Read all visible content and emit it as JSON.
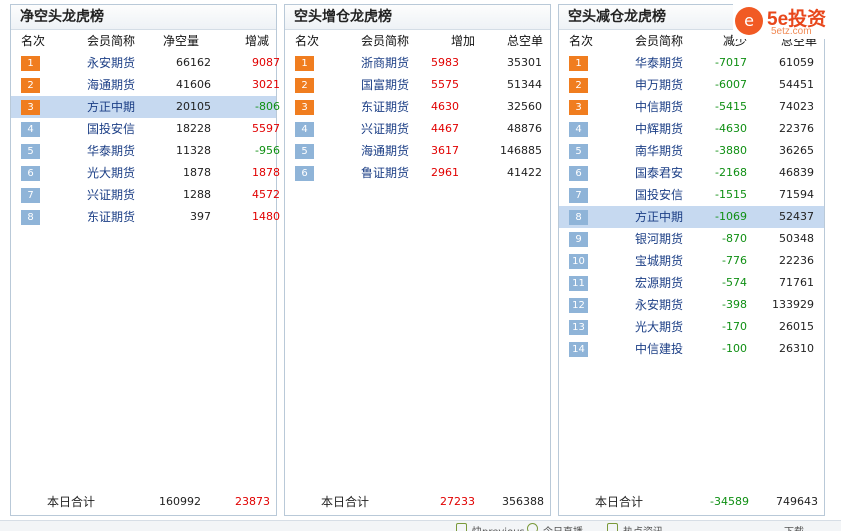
{
  "panels": [
    {
      "title": "净空头龙虎榜",
      "headers": [
        "名次",
        "会员简称",
        "净空量",
        "增减"
      ],
      "rows": [
        {
          "rank": "1",
          "name": "永安期货",
          "v1": "66162",
          "v2": "9087",
          "c2": "red"
        },
        {
          "rank": "2",
          "name": "海通期货",
          "v1": "41606",
          "v2": "3021",
          "c2": "red"
        },
        {
          "rank": "3",
          "name": "方正中期",
          "v1": "20105",
          "v2": "-806",
          "c2": "green",
          "selected": true
        },
        {
          "rank": "4",
          "name": "国投安信",
          "v1": "18228",
          "v2": "5597",
          "c2": "red"
        },
        {
          "rank": "5",
          "name": "华泰期货",
          "v1": "11328",
          "v2": "-956",
          "c2": "green"
        },
        {
          "rank": "6",
          "name": "光大期货",
          "v1": "1878",
          "v2": "1878",
          "c2": "red"
        },
        {
          "rank": "7",
          "name": "兴证期货",
          "v1": "1288",
          "v2": "4572",
          "c2": "red"
        },
        {
          "rank": "8",
          "name": "东证期货",
          "v1": "397",
          "v2": "1480",
          "c2": "red"
        }
      ],
      "total": {
        "label": "本日合计",
        "v1": "160992",
        "v2": "23873",
        "c1": "black",
        "c2": "red"
      }
    },
    {
      "title": "空头增仓龙虎榜",
      "headers": [
        "名次",
        "会员简称",
        "增加",
        "总空单"
      ],
      "rows": [
        {
          "rank": "1",
          "name": "浙商期货",
          "v1": "5983",
          "v2": "35301",
          "c1": "red"
        },
        {
          "rank": "2",
          "name": "国富期货",
          "v1": "5575",
          "v2": "51344",
          "c1": "red"
        },
        {
          "rank": "3",
          "name": "东证期货",
          "v1": "4630",
          "v2": "32560",
          "c1": "red"
        },
        {
          "rank": "4",
          "name": "兴证期货",
          "v1": "4467",
          "v2": "48876",
          "c1": "red"
        },
        {
          "rank": "5",
          "name": "海通期货",
          "v1": "3617",
          "v2": "146885",
          "c1": "red"
        },
        {
          "rank": "6",
          "name": "鲁证期货",
          "v1": "2961",
          "v2": "41422",
          "c1": "red"
        }
      ],
      "total": {
        "label": "本日合计",
        "v1": "27233",
        "v2": "356388",
        "c1": "red",
        "c2": "black"
      }
    },
    {
      "title": "空头减仓龙虎榜",
      "headers": [
        "名次",
        "会员简称",
        "减少",
        "总空单"
      ],
      "rows": [
        {
          "rank": "1",
          "name": "华泰期货",
          "v1": "-7017",
          "v2": "61059",
          "c1": "green"
        },
        {
          "rank": "2",
          "name": "申万期货",
          "v1": "-6007",
          "v2": "54451",
          "c1": "green"
        },
        {
          "rank": "3",
          "name": "中信期货",
          "v1": "-5415",
          "v2": "74023",
          "c1": "green"
        },
        {
          "rank": "4",
          "name": "中辉期货",
          "v1": "-4630",
          "v2": "22376",
          "c1": "green"
        },
        {
          "rank": "5",
          "name": "南华期货",
          "v1": "-3880",
          "v2": "36265",
          "c1": "green"
        },
        {
          "rank": "6",
          "name": "国泰君安",
          "v1": "-2168",
          "v2": "46839",
          "c1": "green"
        },
        {
          "rank": "7",
          "name": "国投安信",
          "v1": "-1515",
          "v2": "71594",
          "c1": "green"
        },
        {
          "rank": "8",
          "name": "方正中期",
          "v1": "-1069",
          "v2": "52437",
          "c1": "green",
          "selected": true
        },
        {
          "rank": "9",
          "name": "银河期货",
          "v1": "-870",
          "v2": "50348",
          "c1": "green"
        },
        {
          "rank": "10",
          "name": "宝城期货",
          "v1": "-776",
          "v2": "22236",
          "c1": "green"
        },
        {
          "rank": "11",
          "name": "宏源期货",
          "v1": "-574",
          "v2": "71761",
          "c1": "green"
        },
        {
          "rank": "12",
          "name": "永安期货",
          "v1": "-398",
          "v2": "133929",
          "c1": "green"
        },
        {
          "rank": "13",
          "name": "光大期货",
          "v1": "-170",
          "v2": "26015",
          "c1": "green"
        },
        {
          "rank": "14",
          "name": "中信建投",
          "v1": "-100",
          "v2": "26310",
          "c1": "green"
        }
      ],
      "total": {
        "label": "本日合计",
        "v1": "-34589",
        "v2": "749643",
        "c1": "green",
        "c2": "black"
      }
    }
  ],
  "logo": {
    "mark": "e",
    "text": "5e投资",
    "sub": "5etz.com"
  },
  "statusbar": {
    "items": [
      "快previous",
      "今日直播",
      "热点资讯",
      "下载"
    ]
  },
  "colors": {
    "top_badge": "#f07d1f",
    "rest_badge": "#8fb4d8",
    "selected_row": "#c6d9f0",
    "up": "#e10000",
    "down": "#0f8f13",
    "name": "#1c3f86"
  }
}
